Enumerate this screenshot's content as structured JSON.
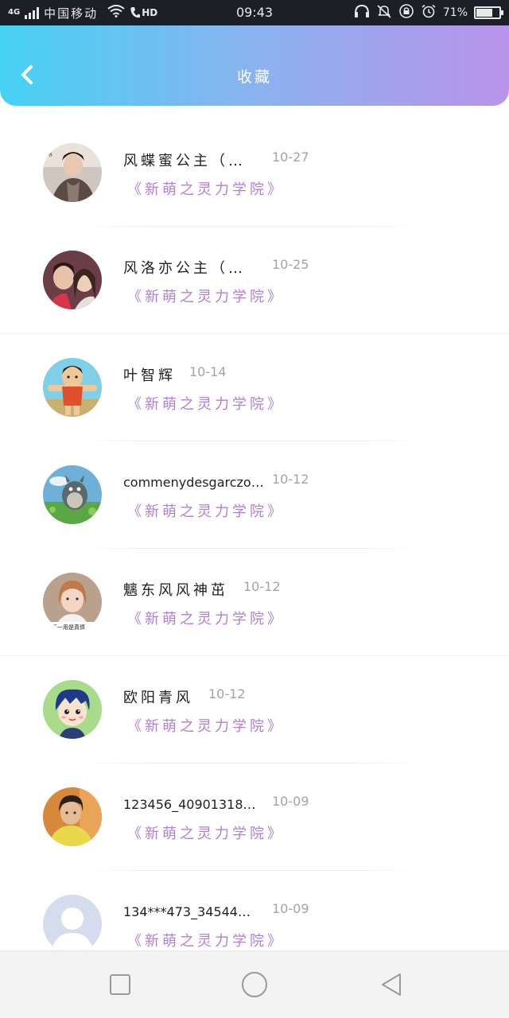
{
  "status_bar": {
    "network_label": "4G",
    "carrier": "中国移动",
    "hd_label": "HD",
    "time": "09:43",
    "battery_percent": "71%",
    "battery_level": 0.71
  },
  "header": {
    "title": "收藏",
    "back_icon": "chevron-left-icon"
  },
  "favorites": [
    {
      "name": "风蝶蜜公主（…",
      "date": "10-27",
      "subtitle": "《新萌之灵力学院》"
    },
    {
      "name": "风洛亦公主（…",
      "date": "10-25",
      "subtitle": "《新萌之灵力学院》"
    },
    {
      "name": "叶智辉",
      "date": "10-14",
      "subtitle": "《新萌之灵力学院》"
    },
    {
      "name": "commenydesgarczo…",
      "date": "10-12",
      "subtitle": "《新萌之灵力学院》"
    },
    {
      "name": "魑东风风神茁",
      "date": "10-12",
      "subtitle": "《新萌之灵力学院》"
    },
    {
      "name": "欧阳青风",
      "date": "10-12",
      "subtitle": "《新萌之灵力学院》"
    },
    {
      "name": "123456_40901318…",
      "date": "10-09",
      "subtitle": "《新萌之灵力学院》"
    },
    {
      "name": "134***473_34544…",
      "date": "10-09",
      "subtitle": "《新萌之灵力学院》"
    }
  ],
  "nav_bar": {
    "recent_icon": "square-icon",
    "home_icon": "circle-icon",
    "back_icon": "triangle-back-icon"
  }
}
